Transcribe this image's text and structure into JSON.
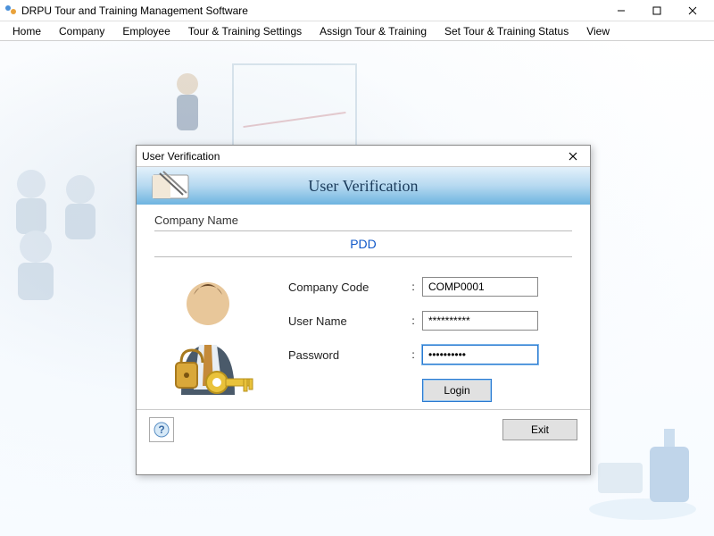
{
  "window": {
    "title": "DRPU Tour and Training Management Software"
  },
  "menu": {
    "items": [
      "Home",
      "Company",
      "Employee",
      "Tour & Training Settings",
      "Assign Tour & Training",
      "Set Tour & Training Status",
      "View"
    ]
  },
  "dialog": {
    "title": "User Verification",
    "header": "User Verification",
    "company_label": "Company Name",
    "company_value": "PDD",
    "fields": {
      "code_label": "Company Code",
      "code_value": "COMP0001",
      "user_label": "User Name",
      "user_value": "**********",
      "pass_label": "Password",
      "pass_value": "••••••••••"
    },
    "login_label": "Login",
    "exit_label": "Exit"
  }
}
